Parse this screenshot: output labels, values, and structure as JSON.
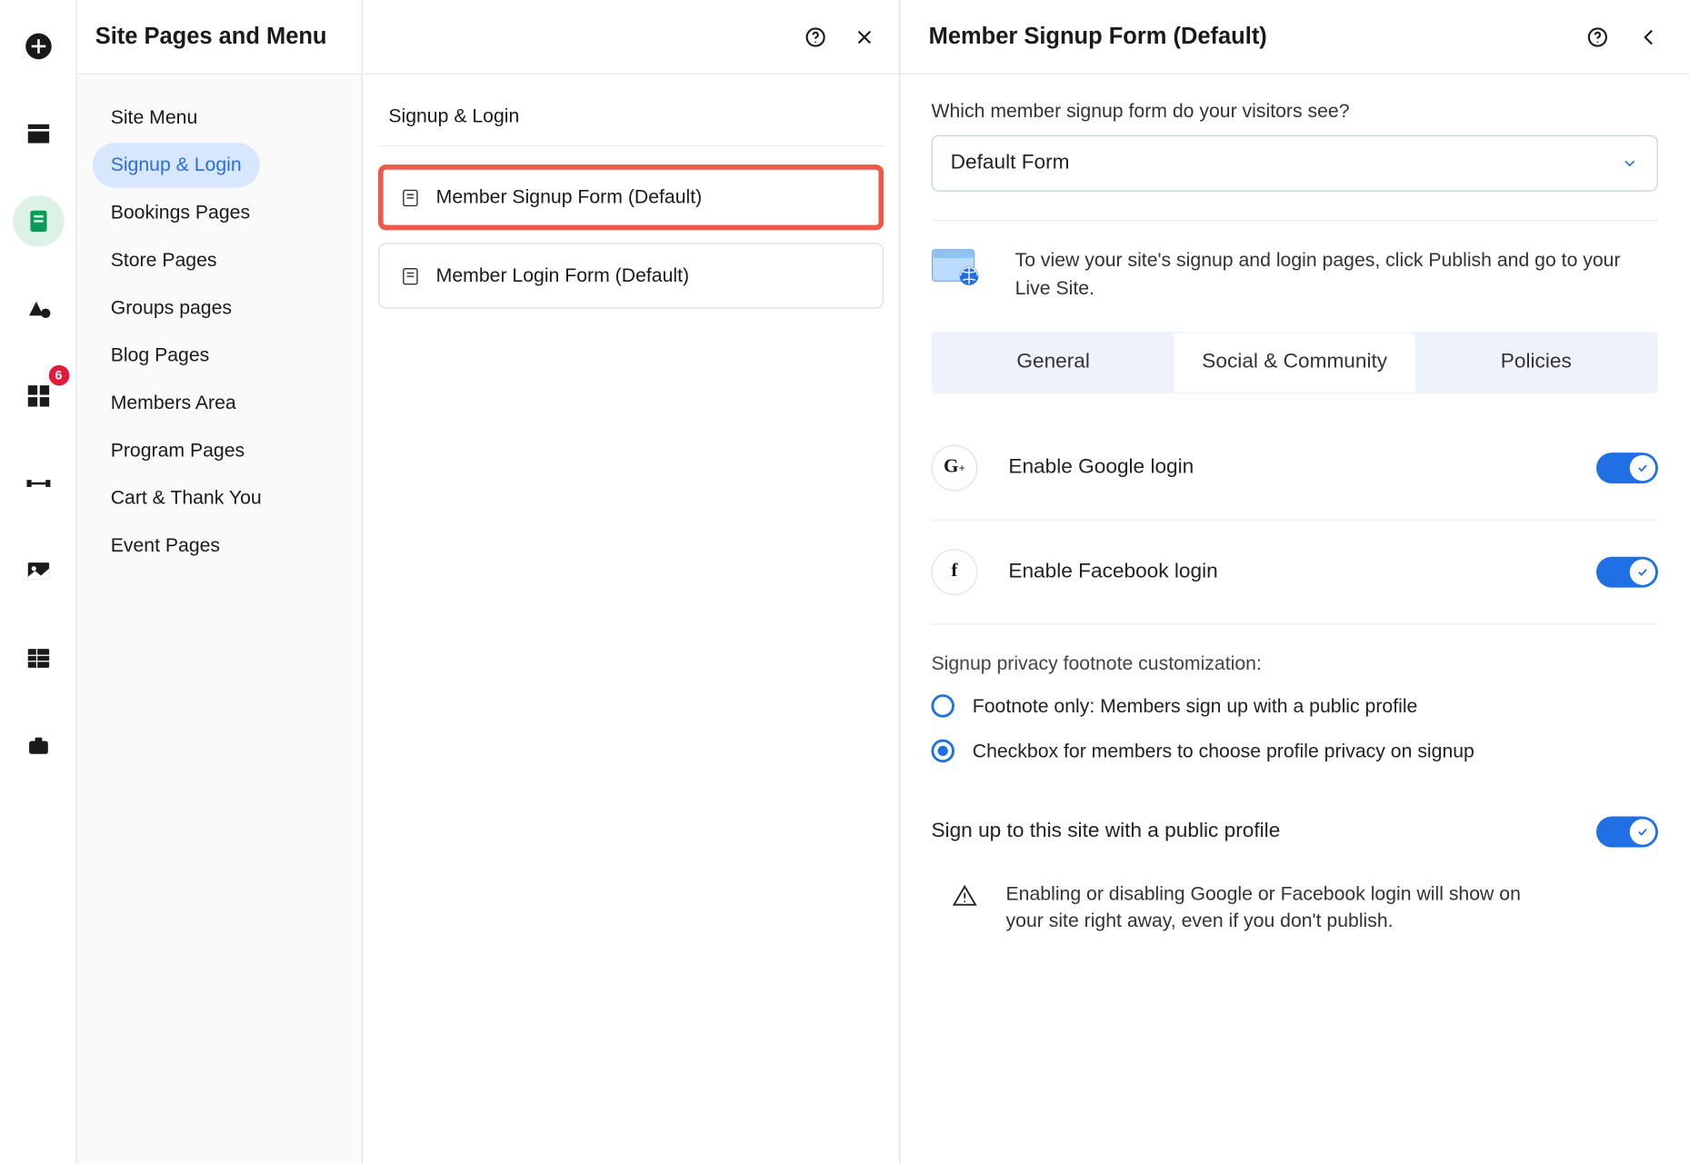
{
  "rail": {
    "badge": "6"
  },
  "panelTitle": "Site Pages and Menu",
  "sidebar": {
    "items": [
      "Site Menu",
      "Signup & Login",
      "Bookings Pages",
      "Store Pages",
      "Groups pages",
      "Blog Pages",
      "Members Area",
      "Program Pages",
      "Cart & Thank You",
      "Event Pages"
    ],
    "selectedIndex": 1
  },
  "middle": {
    "section": "Signup & Login",
    "options": [
      "Member Signup Form (Default)",
      "Member Login Form (Default)"
    ],
    "highlightIndex": 0
  },
  "right": {
    "title": "Member Signup Form (Default)",
    "question": "Which member signup form do your visitors see?",
    "selectValue": "Default Form",
    "infoText": "To view your site's signup and login pages, click Publish and go to your Live Site.",
    "tabs": [
      "General",
      "Social & Community",
      "Policies"
    ],
    "activeTab": 1,
    "settings": {
      "google": "Enable Google login",
      "facebook": "Enable Facebook login"
    },
    "privacyHeading": "Signup privacy footnote customization:",
    "radios": [
      "Footnote only: Members sign up with a public profile",
      "Checkbox for members to choose profile privacy on signup"
    ],
    "radioSelected": 1,
    "publicProfile": "Sign up to this site with a public profile",
    "note": "Enabling or disabling Google or Facebook login will show on your site right away, even if you don't publish."
  }
}
